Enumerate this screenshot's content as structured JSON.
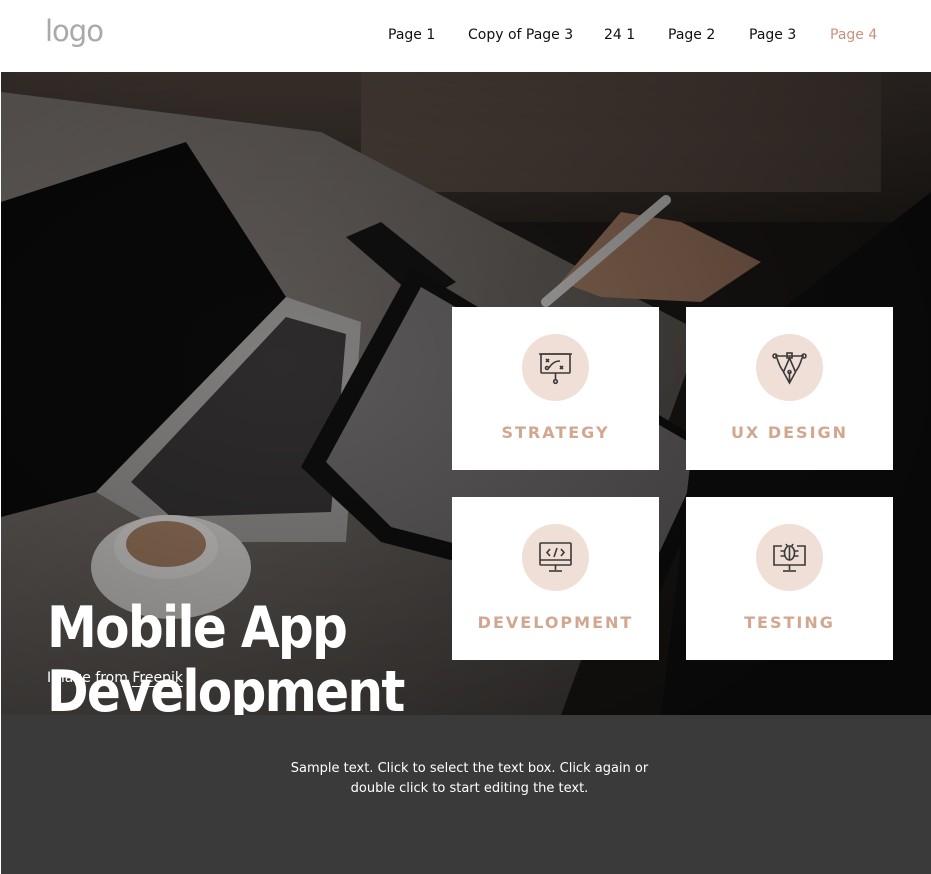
{
  "header": {
    "logo": "logo",
    "nav": [
      {
        "label": "Page 1"
      },
      {
        "label": "Copy of Page 3"
      },
      {
        "label": "24 1"
      },
      {
        "label": "Page 2"
      },
      {
        "label": "Page 3"
      },
      {
        "label": "Page 4",
        "active": true
      }
    ]
  },
  "hero": {
    "title_line1": "Mobile App",
    "title_line2": "Development",
    "credit_prefix": "Image from",
    "credit_link": "Freepik"
  },
  "services": [
    {
      "label": "STRATEGY",
      "icon": "strategy-board-icon"
    },
    {
      "label": "UX DESIGN",
      "icon": "pen-tool-icon"
    },
    {
      "label": "DEVELOPMENT",
      "icon": "code-monitor-icon"
    },
    {
      "label": "TESTING",
      "icon": "bug-monitor-icon"
    }
  ],
  "footer": {
    "text": "Sample text. Click to select the text box. Click again or double click to start editing the text."
  },
  "colors": {
    "accent": "#c9907e",
    "card_label": "#d1a78f",
    "icon_circle": "#f0dfd6",
    "footer_bg": "#3a3a3a"
  }
}
